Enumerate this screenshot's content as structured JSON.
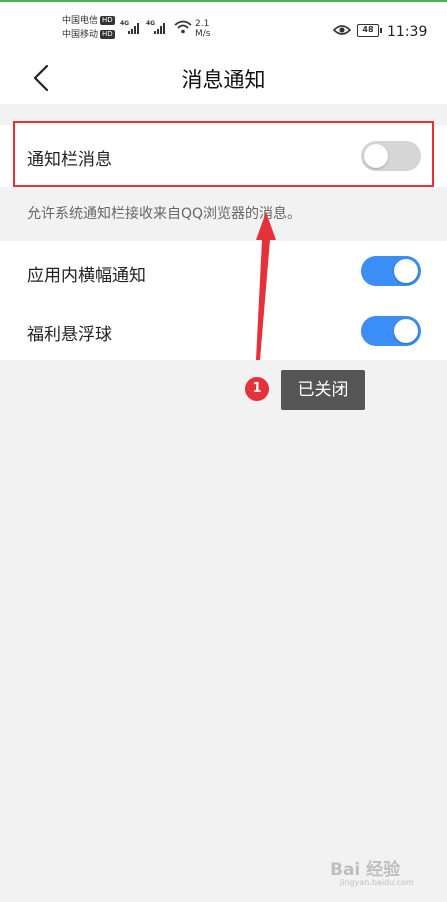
{
  "status_bar": {
    "carrier1": "中国电信",
    "carrier2": "中国移动",
    "hd_label": "HD",
    "network1": "4G",
    "network2": "4G",
    "speed_value": "2.1",
    "speed_unit": "M/s",
    "battery": "48",
    "time": "11:39",
    "icons": [
      "signal-icon",
      "wifi-icon",
      "eye-icon",
      "battery-icon"
    ]
  },
  "header": {
    "title": "消息通知",
    "back_icon": "back-chevron-icon"
  },
  "settings": {
    "notification_bar": {
      "label": "通知栏消息",
      "enabled": false
    },
    "notification_bar_desc": "允许系统通知栏接收来自QQ浏览器的消息。",
    "in_app_banner": {
      "label": "应用内横幅通知",
      "enabled": true
    },
    "floating_ball": {
      "label": "福利悬浮球",
      "enabled": true
    }
  },
  "annotation": {
    "step_number": "1",
    "callout_text": "已关闭",
    "highlight_color": "#e5323a",
    "arrow_color": "#e5323a"
  },
  "watermark": {
    "text": "Bai 经验",
    "subtext": "jingyan.baidu.com"
  },
  "colors": {
    "toggle_on": "#3a8ef6",
    "toggle_off": "#d6d6d6",
    "background": "#f2f2f2"
  }
}
